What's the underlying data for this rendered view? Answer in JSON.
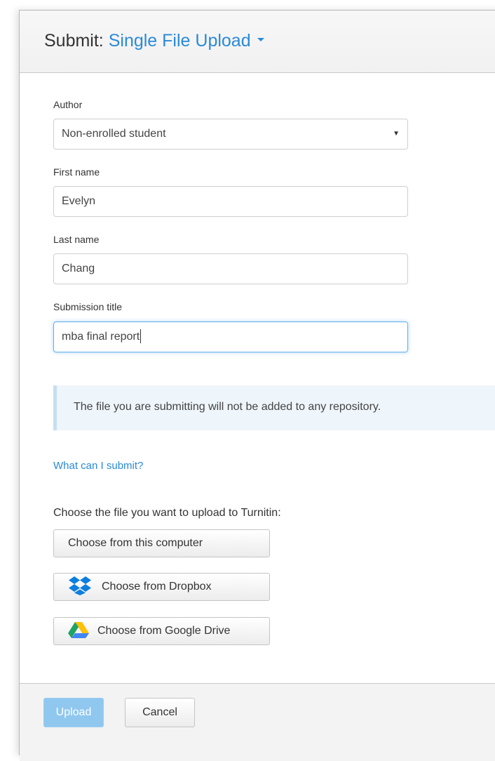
{
  "header": {
    "prefix": "Submit:",
    "mode_label": "Single File Upload"
  },
  "form": {
    "author": {
      "label": "Author",
      "selected": "Non-enrolled student"
    },
    "first_name": {
      "label": "First name",
      "value": "Evelyn"
    },
    "last_name": {
      "label": "Last name",
      "value": "Chang"
    },
    "submission_title": {
      "label": "Submission title",
      "value": "mba final report"
    }
  },
  "info": {
    "message": "The file you are submitting will not be added to any repository."
  },
  "help_link": "What can I submit?",
  "upload": {
    "prompt": "Choose the file you want to upload to Turnitin:",
    "computer_label": "Choose from this computer",
    "dropbox_label": "Choose from Dropbox",
    "gdrive_label": "Choose from Google Drive"
  },
  "footer": {
    "upload_label": "Upload",
    "cancel_label": "Cancel"
  },
  "colors": {
    "link": "#2a8ad9",
    "upload_disabled": "#8fc7ef",
    "info_bg": "#eef5fb",
    "dropbox_blue": "#0d7ee0"
  },
  "icons": [
    "caret-down-icon",
    "dropbox-icon",
    "google-drive-icon"
  ]
}
